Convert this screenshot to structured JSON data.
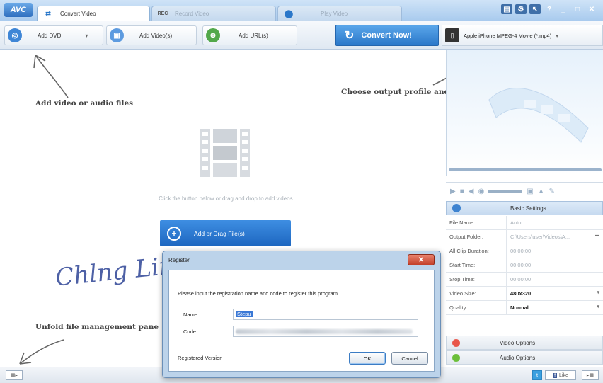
{
  "app": {
    "logo": "AVC"
  },
  "tabs": [
    {
      "label": "Convert Video",
      "icon": "convert-icon",
      "active": true
    },
    {
      "label": "Record Video",
      "icon": "record-icon",
      "badge": "REC",
      "active": false
    },
    {
      "label": "Play Video",
      "icon": "play-icon",
      "active": false
    }
  ],
  "window_controls": {
    "minimize": "_",
    "maximize": "□",
    "close": "✕",
    "help": "?"
  },
  "toolbar": {
    "add_dvd": "Add DVD",
    "add_videos": "Add Video(s)",
    "add_url": "Add URL(s)",
    "convert_now": "Convert Now!",
    "profile": "Apple iPhone MPEG-4 Movie (*.mp4)"
  },
  "annotations": {
    "add_files": "Add video or audio files",
    "choose_profile": "Choose output profile and convert",
    "unfold": "Unfold file management pane"
  },
  "main": {
    "hint": "Click the button below or drag and drop to add videos.",
    "add_button": "Add or Drag File(s)",
    "signature": "Chlng Lin"
  },
  "settings": {
    "title": "Basic Settings",
    "rows": [
      {
        "key": "File Name:",
        "value": "Auto"
      },
      {
        "key": "Output Folder:",
        "value": "C:\\Users\\user\\Videos\\A..."
      },
      {
        "key": "All Clip Duration:",
        "value": "00:00:00"
      },
      {
        "key": "Start Time:",
        "value": "00:00:00"
      },
      {
        "key": "Stop Time:",
        "value": "00:00:00"
      },
      {
        "key": "Video Size:",
        "value": "480x320"
      },
      {
        "key": "Quality:",
        "value": "Normal"
      }
    ],
    "video_options": "Video Options",
    "audio_options": "Audio Options"
  },
  "colors": {
    "accent": "#2a77c9",
    "dialog_frame": "#bcd3ea",
    "video_opt": "#e8564a",
    "audio_opt": "#6bbf3a"
  },
  "dialog": {
    "title": "Register",
    "close": "✕",
    "message": "Please input the registration name and code to register this program.",
    "name_label": "Name:",
    "name_value": "Stepu",
    "code_label": "Code:",
    "footer": "Registered Version",
    "ok": "OK",
    "cancel": "Cancel"
  },
  "statusbar": {
    "like": "Like"
  }
}
